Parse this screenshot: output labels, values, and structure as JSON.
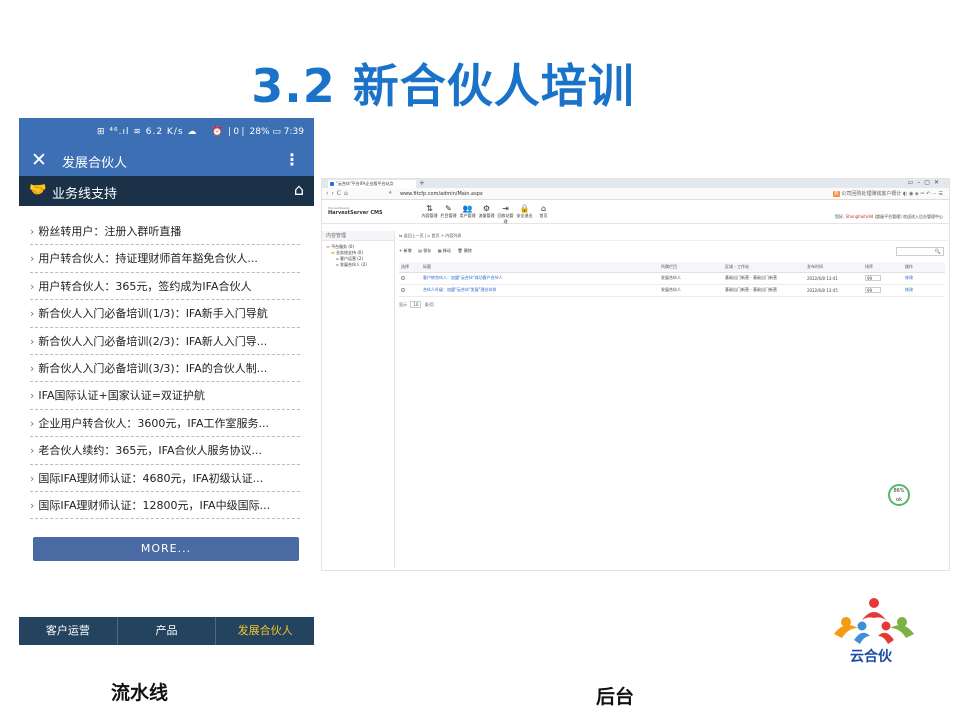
{
  "slide": {
    "title": "3.2 新合伙人培训",
    "caption_left": "流水线",
    "caption_right": "后台"
  },
  "phone": {
    "status_left": "⊞ ⁴⁶.ıl ≋ 6.2 K/s ☁",
    "status_right": "⏰ ❘0❘ 28% ▭ 7:39",
    "title": "发展合伙人",
    "section": "业务线支持",
    "items": [
      "粉丝转用户：注册入群听直播",
      "用户转合伙人：持证理财师首年豁免合伙人...",
      "用户转合伙人：365元，签约成为IFA合伙人",
      "新合伙人入门必备培训(1/3)：IFA新手入门导航",
      "新合伙人入门必备培训(2/3)：IFA新人入门导...",
      "新合伙人入门必备培训(3/3)：IFA的合伙人制...",
      "IFA国际认证+国家认证=双证护航",
      "企业用户转合伙人：3600元，IFA工作室服务...",
      "老合伙人续约：365元，IFA合伙人服务协议...",
      "国际IFA理财师认证：4680元，IFA初级认证...",
      "国际IFA理财师认证：12800元，IFA中级国际..."
    ],
    "more_label": "MORE...",
    "tabs": [
      "客户运营",
      "产品",
      "发展合伙人"
    ],
    "active_tab": 2
  },
  "admin": {
    "tab_title": "\"云合伙\"平台IFA企业版平台站点",
    "url": "www.fitcfp.com/admin/Main.aspx",
    "ext_text": "公司回购处理赚钱客户概计",
    "brand": "HarvestServer CMS",
    "brand_sub": "HarvestDesign",
    "menu": [
      {
        "icon": "⇅",
        "label": "内容管理"
      },
      {
        "icon": "✎",
        "label": "栏目管理"
      },
      {
        "icon": "👥",
        "label": "用户管理"
      },
      {
        "icon": "⚙",
        "label": "流量管理"
      },
      {
        "icon": "⇥",
        "label": "回收站管理"
      },
      {
        "icon": "🔒",
        "label": "安全退出"
      },
      {
        "icon": "⌂",
        "label": "首页"
      }
    ],
    "user_label": "您好,",
    "user_name": "Shanghaifu9d",
    "user_suffix": "(超级平台管理)  欢迎进入后台管理中心",
    "sidebar_title": "内容管理",
    "tree": [
      {
        "level": 1,
        "label": "平台服务 (0)"
      },
      {
        "level": 2,
        "label": "业务线支持 (0)"
      },
      {
        "level": 3,
        "label": "客户运营 (2)"
      },
      {
        "level": 3,
        "label": "发展合伙人 (2)"
      }
    ],
    "breadcrumb": "⇆ 返回上一页  |  ⌂ 首页 > 内容列表",
    "toolbar": [
      "+ 新增",
      "▤ 保存",
      "▦ 移动",
      "🗑 删除"
    ],
    "search_icon": "🔍",
    "columns": [
      "选择",
      "标题",
      "所属栏目",
      "区域 - 工作站",
      "发布时间",
      "排序",
      "操作"
    ],
    "rows": [
      {
        "title": "客户转合伙人：加盟\"云合伙\"成功客户合伙人",
        "category": "发展合伙人",
        "region": "基础出门新营 - 基础出门新营",
        "date": "2022/6/8 13:41",
        "sort": "99",
        "op": "修改"
      },
      {
        "title": "合伙人升级：加盟\"云合伙\"发展\"理业伙伴",
        "category": "发展合伙人",
        "region": "基础出门新营 - 基础出门新营",
        "date": "2022/6/8 13:45",
        "sort": "99",
        "op": "修改"
      }
    ],
    "pager": [
      "显示",
      "10",
      "条/页"
    ],
    "progress": "86%",
    "progress_sub": "ok"
  },
  "logo": {
    "text": "云合伙",
    "colors": [
      "#e53935",
      "#f39c12",
      "#3f8fd8",
      "#7cb342"
    ]
  }
}
